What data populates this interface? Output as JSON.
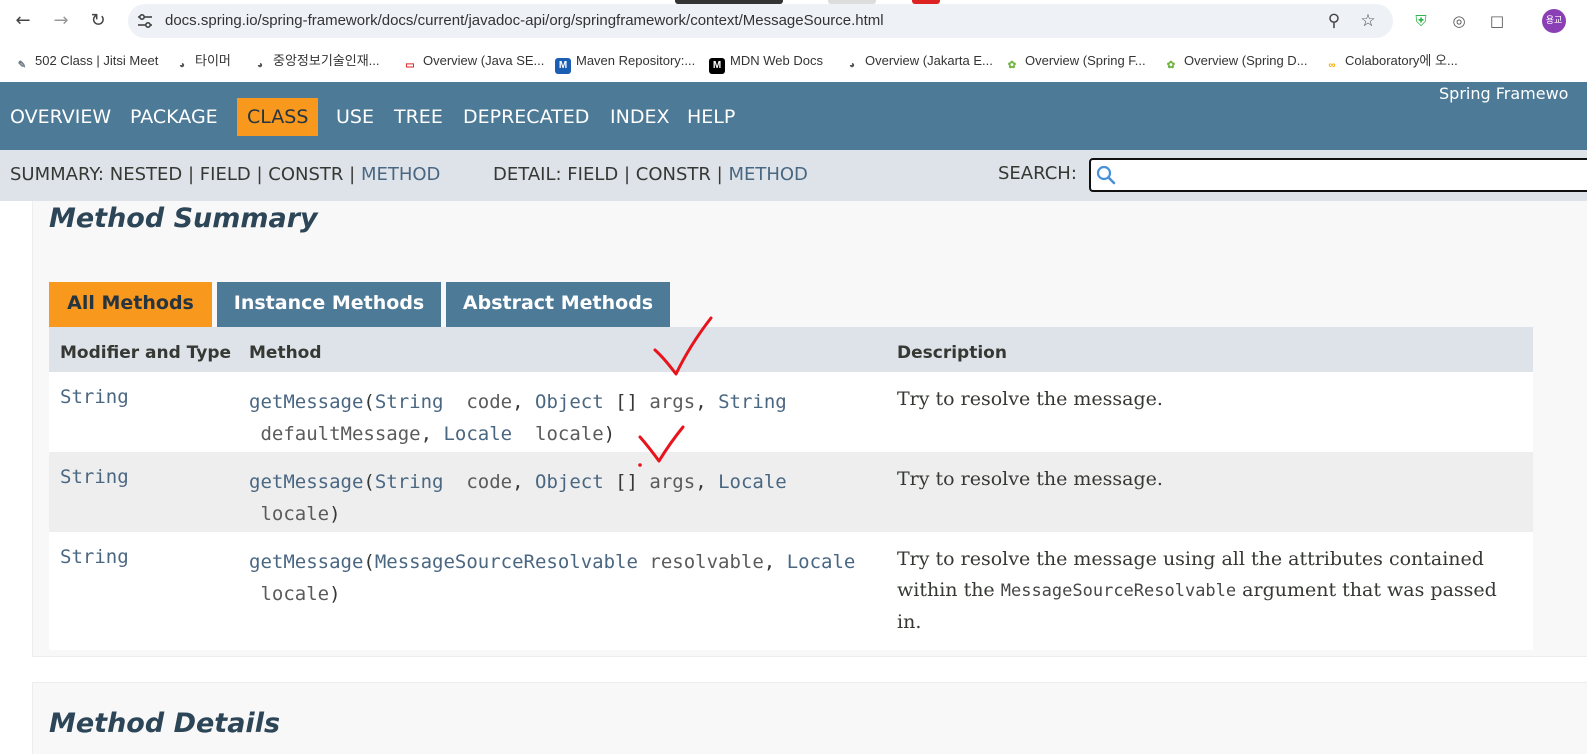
{
  "browser": {
    "url": "docs.spring.io/spring-framework/docs/current/javadoc-api/org/springframework/context/MessageSource.html",
    "avatar_text": "용교",
    "bookmarks": [
      {
        "label": "502 Class | Jitsi Meet",
        "icon": "jitsi-icon",
        "color": "#6f7a88"
      },
      {
        "label": "타이머",
        "icon": "globe-icon",
        "color": "#555555"
      },
      {
        "label": "중앙정보기술인재...",
        "icon": "globe-icon",
        "color": "#555555"
      },
      {
        "label": "Overview (Java SE...",
        "icon": "oracle-icon",
        "color": "#e3262b"
      },
      {
        "label": "Maven Repository:...",
        "icon": "maven-icon",
        "color": "#1a5fb4"
      },
      {
        "label": "MDN Web Docs",
        "icon": "mdn-icon",
        "color": "#000000"
      },
      {
        "label": "Overview (Jakarta E...",
        "icon": "globe-icon",
        "color": "#555555"
      },
      {
        "label": "Overview (Spring F...",
        "icon": "spring-icon",
        "color": "#6db33f"
      },
      {
        "label": "Overview (Spring D...",
        "icon": "spring-icon",
        "color": "#6db33f"
      },
      {
        "label": "Colaboratory에 오...",
        "icon": "colab-icon",
        "color": "#f9ab00"
      }
    ]
  },
  "topnav": {
    "items": [
      "OVERVIEW",
      "PACKAGE",
      "CLASS",
      "USE",
      "TREE",
      "DEPRECATED",
      "INDEX",
      "HELP"
    ],
    "active": "CLASS",
    "about": "Spring Framewo"
  },
  "subnav": {
    "summary_label": "SUMMARY:",
    "summary_nested": "NESTED",
    "summary_field": "FIELD",
    "summary_constr": "CONSTR",
    "summary_method": "METHOD",
    "detail_label": "DETAIL:",
    "detail_field": "FIELD",
    "detail_constr": "CONSTR",
    "detail_method": "METHOD",
    "sep": "|",
    "search_label": "SEARCH:"
  },
  "summary": {
    "title": "Method Summary",
    "tabs": [
      "All Methods",
      "Instance Methods",
      "Abstract Methods"
    ],
    "active_tab": "All Methods",
    "headers": {
      "type": "Modifier and Type",
      "method": "Method",
      "desc": "Description"
    },
    "rows": [
      {
        "type": "String",
        "line1": [
          [
            "lnk",
            "getMessage"
          ],
          [
            "plain",
            "("
          ],
          [
            "lnk",
            "String"
          ],
          [
            "par",
            "  code"
          ],
          [
            "plain",
            ", "
          ],
          [
            "lnk",
            "Object"
          ],
          [
            "plain",
            " [] "
          ],
          [
            "par",
            "args"
          ],
          [
            "plain",
            ", "
          ],
          [
            "lnk",
            "String"
          ]
        ],
        "line2": [
          [
            "par",
            " defaultMessage"
          ],
          [
            "plain",
            ", "
          ],
          [
            "lnk",
            "Locale"
          ],
          [
            "par",
            "  locale"
          ],
          [
            "plain",
            ")"
          ]
        ],
        "desc": "Try to resolve the message."
      },
      {
        "type": "String",
        "line1": [
          [
            "lnk",
            "getMessage"
          ],
          [
            "plain",
            "("
          ],
          [
            "lnk",
            "String"
          ],
          [
            "par",
            "  code"
          ],
          [
            "plain",
            ", "
          ],
          [
            "lnk",
            "Object"
          ],
          [
            "plain",
            " [] "
          ],
          [
            "par",
            "args"
          ],
          [
            "plain",
            ", "
          ],
          [
            "lnk",
            "Locale"
          ]
        ],
        "line2": [
          [
            "par",
            " locale"
          ],
          [
            "plain",
            ")"
          ]
        ],
        "desc": "Try to resolve the message."
      },
      {
        "type": "String",
        "line1": [
          [
            "lnk",
            "getMessage"
          ],
          [
            "plain",
            "("
          ],
          [
            "lnk",
            "MessageSourceResolvable"
          ],
          [
            "par",
            " resolvable"
          ],
          [
            "plain",
            ", "
          ],
          [
            "lnk",
            "Locale"
          ]
        ],
        "line2": [
          [
            "par",
            " locale"
          ],
          [
            "plain",
            ")"
          ]
        ],
        "desc_pre": "Try to resolve the message using all the attributes contained within the ",
        "desc_code": "MessageSourceResolvable",
        "desc_post": " argument that was passed in."
      }
    ]
  },
  "details": {
    "title": "Method Details"
  },
  "colors": {
    "nav": "#4d7a97",
    "accent": "#f8981d",
    "subnav": "#dee3e9",
    "annotation": "#e8141c"
  }
}
